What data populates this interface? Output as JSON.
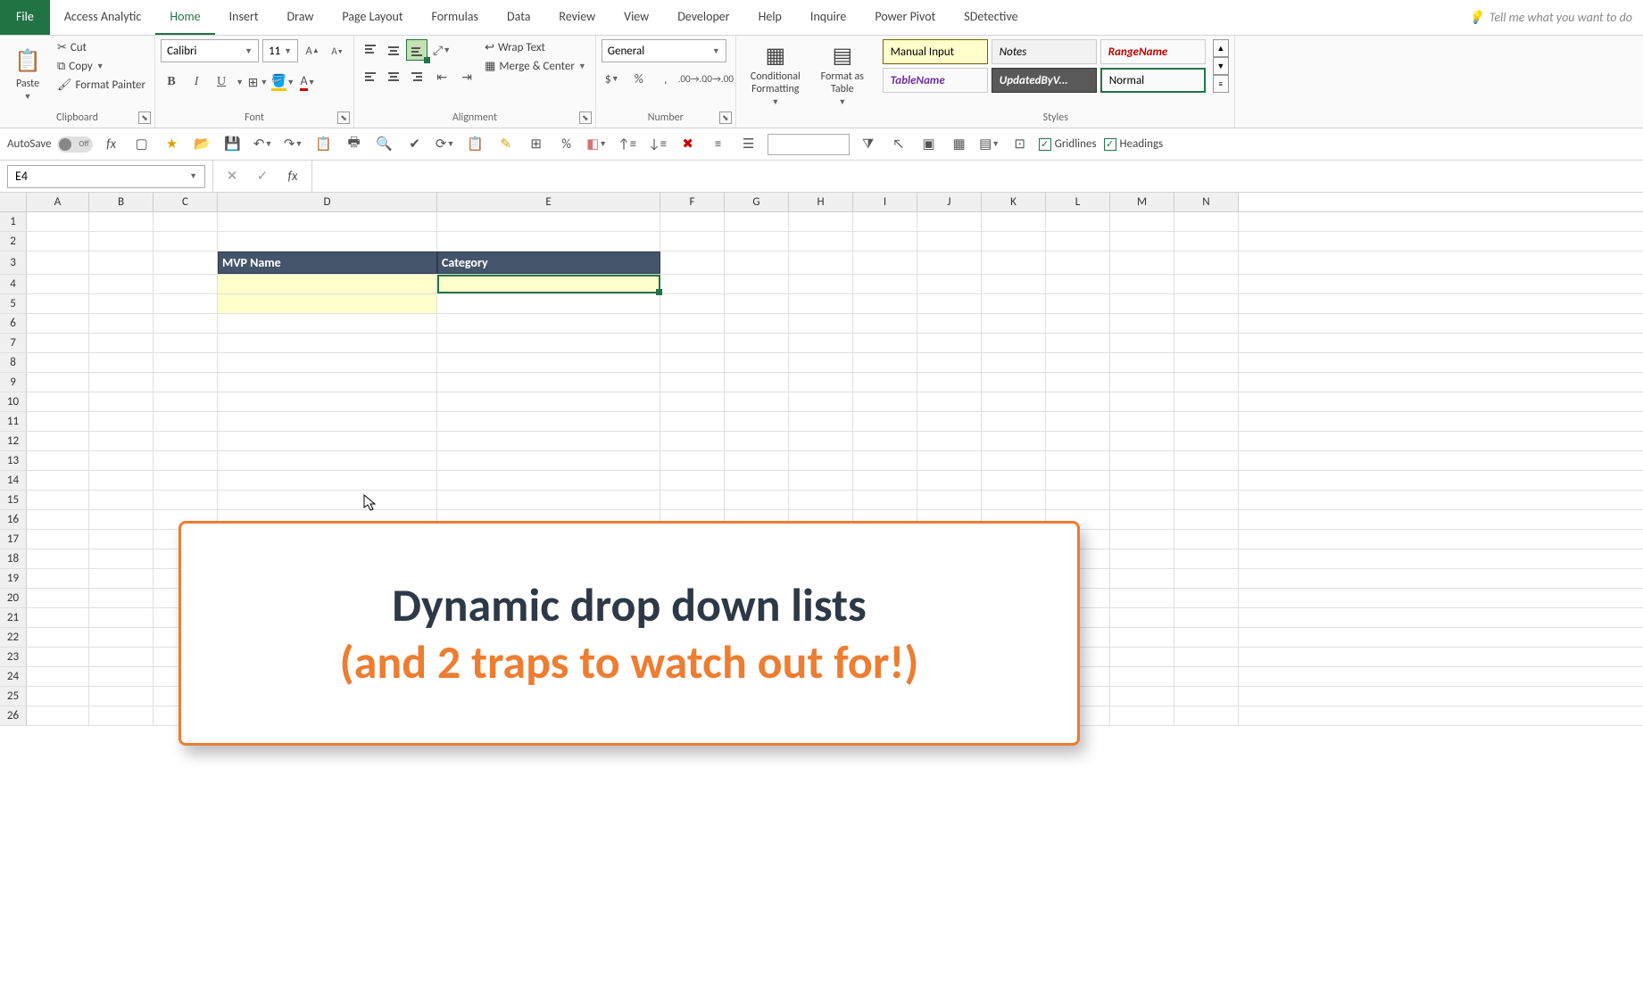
{
  "tabs": {
    "file": "File",
    "items": [
      "Access Analytic",
      "Home",
      "Insert",
      "Draw",
      "Page Layout",
      "Formulas",
      "Data",
      "Review",
      "View",
      "Developer",
      "Help",
      "Inquire",
      "Power Pivot",
      "SDetective"
    ],
    "active": "Home",
    "tell_me": "Tell me what you want to do"
  },
  "clipboard": {
    "paste": "Paste",
    "cut": "Cut",
    "copy": "Copy",
    "format_painter": "Format Painter",
    "label": "Clipboard"
  },
  "font": {
    "name": "Calibri",
    "size": "11",
    "bold": "B",
    "italic": "I",
    "underline": "U",
    "label": "Font"
  },
  "alignment": {
    "wrap": "Wrap Text",
    "merge": "Merge & Center",
    "label": "Alignment"
  },
  "number": {
    "format": "General",
    "label": "Number"
  },
  "cond": {
    "conditional": "Conditional Formatting",
    "format_as": "Format as Table",
    "label": ""
  },
  "styles": {
    "manual": "Manual Input",
    "notes": "Notes",
    "range": "RangeName",
    "table": "TableName",
    "updated": "UpdatedByV...",
    "normal": "Normal",
    "label": "Styles"
  },
  "qat": {
    "autosave": "AutoSave",
    "autosave_state": "Off",
    "gridlines": "Gridlines",
    "headings": "Headings"
  },
  "fbar": {
    "namebox": "E4",
    "fx": "fx"
  },
  "cols": [
    "A",
    "B",
    "C",
    "D",
    "E",
    "F",
    "G",
    "H",
    "I",
    "J",
    "K",
    "L",
    "M",
    "N"
  ],
  "rows": [
    "1",
    "2",
    "3",
    "4",
    "5",
    "6",
    "7",
    "8",
    "9",
    "10",
    "11",
    "12",
    "13",
    "14",
    "15",
    "16",
    "17",
    "18",
    "19",
    "20",
    "21",
    "22",
    "23",
    "24",
    "25",
    "26"
  ],
  "sheet": {
    "d3": "MVP Name",
    "e3": "Category"
  },
  "annot": {
    "line1": "Dynamic drop down lists",
    "line2": "(and 2 traps to watch out for!)"
  }
}
